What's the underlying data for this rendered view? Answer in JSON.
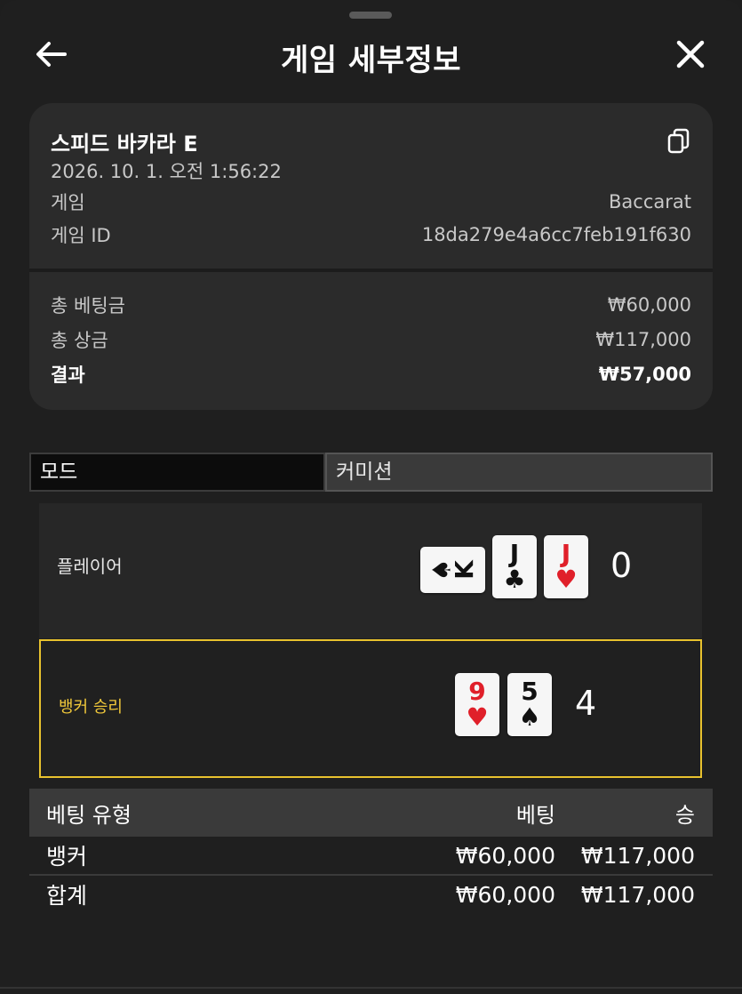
{
  "header": {
    "title": "게임 세부정보",
    "back_icon": "arrow-left-icon",
    "close_icon": "close-icon"
  },
  "game": {
    "name": "스피드 바카라 E",
    "datetime": "2026. 10. 1. 오전 1:56:22",
    "type_label": "게임",
    "type_value": "Baccarat",
    "id_label": "게임 ID",
    "id_value": "18da279e4a6cc7feb191f630",
    "copy_icon": "copy-icon"
  },
  "summary": {
    "total_bet_label": "총 베팅금",
    "total_bet_value": "₩60,000",
    "total_win_label": "총 상금",
    "total_win_value": "₩117,000",
    "result_label": "결과",
    "result_value": "₩57,000"
  },
  "tabs": {
    "mode": "모드",
    "commission": "커미션"
  },
  "player": {
    "label": "플레이어",
    "score": "0",
    "cards": [
      {
        "rank": "K",
        "suit": "♠",
        "color": "black",
        "rotated": true
      },
      {
        "rank": "J",
        "suit": "♣",
        "color": "black",
        "rotated": false
      },
      {
        "rank": "J",
        "suit": "♥",
        "color": "red",
        "rotated": false
      }
    ]
  },
  "banker": {
    "label": "뱅커 승리",
    "score": "4",
    "cards": [
      {
        "rank": "9",
        "suit": "♥",
        "color": "red",
        "rotated": false
      },
      {
        "rank": "5",
        "suit": "♠",
        "color": "black",
        "rotated": false
      }
    ]
  },
  "bets": {
    "headers": [
      "베팅 유형",
      "베팅",
      "승"
    ],
    "rows": [
      [
        "뱅커",
        "₩60,000",
        "₩117,000"
      ],
      [
        "합계",
        "₩60,000",
        "₩117,000"
      ]
    ]
  },
  "colors": {
    "winner_highlight": "#e8c22e",
    "red_suit": "#e0202a"
  }
}
